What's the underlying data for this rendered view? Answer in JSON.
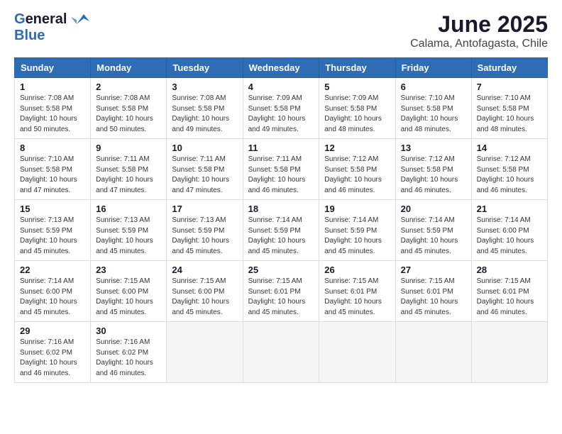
{
  "header": {
    "logo_general": "General",
    "logo_blue": "Blue",
    "month_title": "June 2025",
    "location": "Calama, Antofagasta, Chile"
  },
  "days_of_week": [
    "Sunday",
    "Monday",
    "Tuesday",
    "Wednesday",
    "Thursday",
    "Friday",
    "Saturday"
  ],
  "weeks": [
    [
      {
        "day": "1",
        "sunrise": "Sunrise: 7:08 AM",
        "sunset": "Sunset: 5:58 PM",
        "daylight": "Daylight: 10 hours and 50 minutes."
      },
      {
        "day": "2",
        "sunrise": "Sunrise: 7:08 AM",
        "sunset": "Sunset: 5:58 PM",
        "daylight": "Daylight: 10 hours and 50 minutes."
      },
      {
        "day": "3",
        "sunrise": "Sunrise: 7:08 AM",
        "sunset": "Sunset: 5:58 PM",
        "daylight": "Daylight: 10 hours and 49 minutes."
      },
      {
        "day": "4",
        "sunrise": "Sunrise: 7:09 AM",
        "sunset": "Sunset: 5:58 PM",
        "daylight": "Daylight: 10 hours and 49 minutes."
      },
      {
        "day": "5",
        "sunrise": "Sunrise: 7:09 AM",
        "sunset": "Sunset: 5:58 PM",
        "daylight": "Daylight: 10 hours and 48 minutes."
      },
      {
        "day": "6",
        "sunrise": "Sunrise: 7:10 AM",
        "sunset": "Sunset: 5:58 PM",
        "daylight": "Daylight: 10 hours and 48 minutes."
      },
      {
        "day": "7",
        "sunrise": "Sunrise: 7:10 AM",
        "sunset": "Sunset: 5:58 PM",
        "daylight": "Daylight: 10 hours and 48 minutes."
      }
    ],
    [
      {
        "day": "8",
        "sunrise": "Sunrise: 7:10 AM",
        "sunset": "Sunset: 5:58 PM",
        "daylight": "Daylight: 10 hours and 47 minutes."
      },
      {
        "day": "9",
        "sunrise": "Sunrise: 7:11 AM",
        "sunset": "Sunset: 5:58 PM",
        "daylight": "Daylight: 10 hours and 47 minutes."
      },
      {
        "day": "10",
        "sunrise": "Sunrise: 7:11 AM",
        "sunset": "Sunset: 5:58 PM",
        "daylight": "Daylight: 10 hours and 47 minutes."
      },
      {
        "day": "11",
        "sunrise": "Sunrise: 7:11 AM",
        "sunset": "Sunset: 5:58 PM",
        "daylight": "Daylight: 10 hours and 46 minutes."
      },
      {
        "day": "12",
        "sunrise": "Sunrise: 7:12 AM",
        "sunset": "Sunset: 5:58 PM",
        "daylight": "Daylight: 10 hours and 46 minutes."
      },
      {
        "day": "13",
        "sunrise": "Sunrise: 7:12 AM",
        "sunset": "Sunset: 5:58 PM",
        "daylight": "Daylight: 10 hours and 46 minutes."
      },
      {
        "day": "14",
        "sunrise": "Sunrise: 7:12 AM",
        "sunset": "Sunset: 5:58 PM",
        "daylight": "Daylight: 10 hours and 46 minutes."
      }
    ],
    [
      {
        "day": "15",
        "sunrise": "Sunrise: 7:13 AM",
        "sunset": "Sunset: 5:59 PM",
        "daylight": "Daylight: 10 hours and 45 minutes."
      },
      {
        "day": "16",
        "sunrise": "Sunrise: 7:13 AM",
        "sunset": "Sunset: 5:59 PM",
        "daylight": "Daylight: 10 hours and 45 minutes."
      },
      {
        "day": "17",
        "sunrise": "Sunrise: 7:13 AM",
        "sunset": "Sunset: 5:59 PM",
        "daylight": "Daylight: 10 hours and 45 minutes."
      },
      {
        "day": "18",
        "sunrise": "Sunrise: 7:14 AM",
        "sunset": "Sunset: 5:59 PM",
        "daylight": "Daylight: 10 hours and 45 minutes."
      },
      {
        "day": "19",
        "sunrise": "Sunrise: 7:14 AM",
        "sunset": "Sunset: 5:59 PM",
        "daylight": "Daylight: 10 hours and 45 minutes."
      },
      {
        "day": "20",
        "sunrise": "Sunrise: 7:14 AM",
        "sunset": "Sunset: 5:59 PM",
        "daylight": "Daylight: 10 hours and 45 minutes."
      },
      {
        "day": "21",
        "sunrise": "Sunrise: 7:14 AM",
        "sunset": "Sunset: 6:00 PM",
        "daylight": "Daylight: 10 hours and 45 minutes."
      }
    ],
    [
      {
        "day": "22",
        "sunrise": "Sunrise: 7:14 AM",
        "sunset": "Sunset: 6:00 PM",
        "daylight": "Daylight: 10 hours and 45 minutes."
      },
      {
        "day": "23",
        "sunrise": "Sunrise: 7:15 AM",
        "sunset": "Sunset: 6:00 PM",
        "daylight": "Daylight: 10 hours and 45 minutes."
      },
      {
        "day": "24",
        "sunrise": "Sunrise: 7:15 AM",
        "sunset": "Sunset: 6:00 PM",
        "daylight": "Daylight: 10 hours and 45 minutes."
      },
      {
        "day": "25",
        "sunrise": "Sunrise: 7:15 AM",
        "sunset": "Sunset: 6:01 PM",
        "daylight": "Daylight: 10 hours and 45 minutes."
      },
      {
        "day": "26",
        "sunrise": "Sunrise: 7:15 AM",
        "sunset": "Sunset: 6:01 PM",
        "daylight": "Daylight: 10 hours and 45 minutes."
      },
      {
        "day": "27",
        "sunrise": "Sunrise: 7:15 AM",
        "sunset": "Sunset: 6:01 PM",
        "daylight": "Daylight: 10 hours and 45 minutes."
      },
      {
        "day": "28",
        "sunrise": "Sunrise: 7:15 AM",
        "sunset": "Sunset: 6:01 PM",
        "daylight": "Daylight: 10 hours and 46 minutes."
      }
    ],
    [
      {
        "day": "29",
        "sunrise": "Sunrise: 7:16 AM",
        "sunset": "Sunset: 6:02 PM",
        "daylight": "Daylight: 10 hours and 46 minutes."
      },
      {
        "day": "30",
        "sunrise": "Sunrise: 7:16 AM",
        "sunset": "Sunset: 6:02 PM",
        "daylight": "Daylight: 10 hours and 46 minutes."
      },
      null,
      null,
      null,
      null,
      null
    ]
  ]
}
